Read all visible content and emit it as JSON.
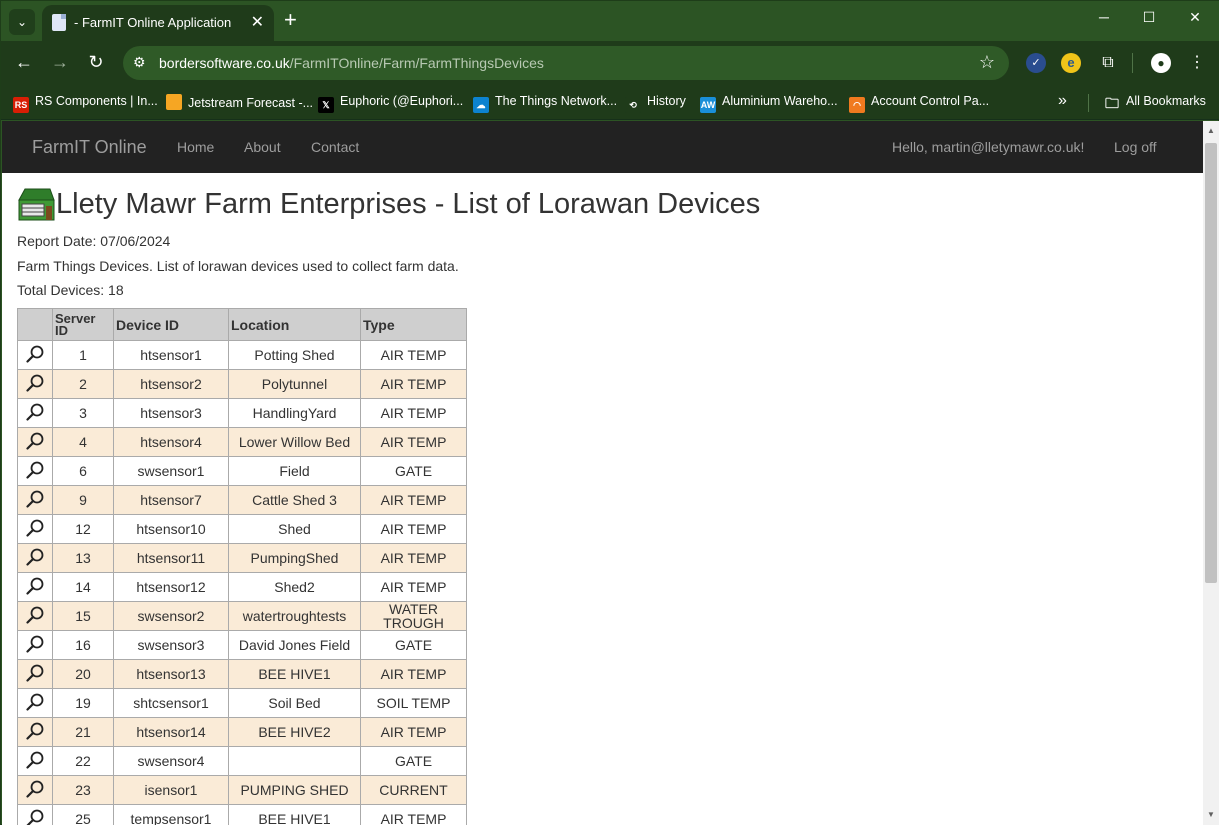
{
  "browser": {
    "tab_title": "- FarmIT Online Application",
    "url_host": "bordersoftware.co.uk",
    "url_path": "/FarmITOnline/Farm/FarmThingsDevices",
    "bookmarks": [
      {
        "label": "RS Components | In...",
        "icon": "rs-logo-icon",
        "icon_text": "RS",
        "color": "#d81e05"
      },
      {
        "label": "Jetstream Forecast -...",
        "icon": "jetstream-icon",
        "icon_text": "",
        "color": "#f6a623"
      },
      {
        "label": "Euphoric (@Euphori...",
        "icon": "x-logo-icon",
        "icon_text": "𝕏",
        "color": "#000000"
      },
      {
        "label": "The Things Network...",
        "icon": "ttn-icon",
        "icon_text": "☁",
        "color": "#0d83d0"
      },
      {
        "label": "History",
        "icon": "history-icon",
        "icon_text": "⟲",
        "color": "#1f3b1a"
      },
      {
        "label": "Aluminium Wareho...",
        "icon": "aluminium-icon",
        "icon_text": "AW",
        "color": "#1a8fd8"
      },
      {
        "label": "Account Control Pa...",
        "icon": "account-icon",
        "icon_text": "◠",
        "color": "#f07a1f"
      }
    ],
    "all_bookmarks_label": "All Bookmarks"
  },
  "navbar": {
    "brand": "FarmIT Online",
    "links": [
      "Home",
      "About",
      "Contact"
    ],
    "greeting": "Hello, martin@lletymawr.co.uk!",
    "logoff": "Log off"
  },
  "page": {
    "title": "Llety Mawr Farm Enterprises - List of Lorawan Devices",
    "report_date": "Report Date: 07/06/2024",
    "description": "Farm Things Devices. List of lorawan devices used to collect farm data.",
    "total": "Total Devices: 18"
  },
  "table": {
    "headers": [
      "Server ID",
      "Device ID",
      "Location",
      "Type"
    ],
    "rows": [
      {
        "server_id": "1",
        "device_id": "htsensor1",
        "location": "Potting Shed",
        "type": "AIR TEMP"
      },
      {
        "server_id": "2",
        "device_id": "htsensor2",
        "location": "Polytunnel",
        "type": "AIR TEMP"
      },
      {
        "server_id": "3",
        "device_id": "htsensor3",
        "location": "HandlingYard",
        "type": "AIR TEMP"
      },
      {
        "server_id": "4",
        "device_id": "htsensor4",
        "location": "Lower Willow Bed",
        "type": "AIR TEMP"
      },
      {
        "server_id": "6",
        "device_id": "swsensor1",
        "location": "Field",
        "type": "GATE"
      },
      {
        "server_id": "9",
        "device_id": "htsensor7",
        "location": "Cattle Shed 3",
        "type": "AIR TEMP"
      },
      {
        "server_id": "12",
        "device_id": "htsensor10",
        "location": "Shed",
        "type": "AIR TEMP"
      },
      {
        "server_id": "13",
        "device_id": "htsensor11",
        "location": "PumpingShed",
        "type": "AIR TEMP"
      },
      {
        "server_id": "14",
        "device_id": "htsensor12",
        "location": "Shed2",
        "type": "AIR TEMP"
      },
      {
        "server_id": "15",
        "device_id": "swsensor2",
        "location": "watertroughtests",
        "type": "WATER TROUGH"
      },
      {
        "server_id": "16",
        "device_id": "swsensor3",
        "location": "David Jones Field",
        "type": "GATE"
      },
      {
        "server_id": "20",
        "device_id": "htsensor13",
        "location": "BEE HIVE1",
        "type": "AIR TEMP"
      },
      {
        "server_id": "19",
        "device_id": "shtcsensor1",
        "location": "Soil Bed",
        "type": "SOIL TEMP"
      },
      {
        "server_id": "21",
        "device_id": "htsensor14",
        "location": "BEE HIVE2",
        "type": "AIR TEMP"
      },
      {
        "server_id": "22",
        "device_id": "swsensor4",
        "location": "",
        "type": "GATE"
      },
      {
        "server_id": "23",
        "device_id": "isensor1",
        "location": "PUMPING SHED",
        "type": "CURRENT"
      },
      {
        "server_id": "25",
        "device_id": "tempsensor1",
        "location": "BEE HIVE1",
        "type": "AIR TEMP"
      }
    ]
  }
}
